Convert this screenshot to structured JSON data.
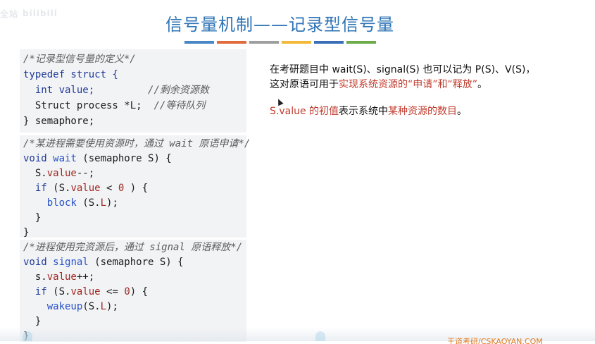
{
  "watermark": {
    "small_text": "全站",
    "logo_text": "bilibili"
  },
  "title": "信号量机制——记录型信号量",
  "colorbar": [
    "#4a86c6",
    "#e06c3c",
    "#9e9e9e",
    "#f2b93b",
    "#3a6fb8",
    "#6cab4a"
  ],
  "code_block_1": [
    [
      {
        "t": "/*记录型信号量的定义*/",
        "c": "comment"
      }
    ],
    [
      {
        "t": "typedef struct {",
        "c": "kw"
      }
    ],
    [
      {
        "t": "  int value;         ",
        "c": "kw"
      },
      {
        "t": "//剩余资源数",
        "c": "comment"
      }
    ],
    [
      {
        "t": "  Struct process ",
        "c": "plain"
      },
      {
        "t": "*L",
        "c": "plain"
      },
      {
        "t": ";  ",
        "c": "plain"
      },
      {
        "t": "//等待队列",
        "c": "comment"
      }
    ],
    [
      {
        "t": "} semaphore;",
        "c": "plain"
      }
    ]
  ],
  "code_block_2": [
    [
      {
        "t": "/*某进程需要使用资源时，通过 wait 原语申请*/",
        "c": "comment"
      }
    ],
    [
      {
        "t": "void ",
        "c": "kw"
      },
      {
        "t": "wait",
        "c": "fn"
      },
      {
        "t": " (semaphore S) {",
        "c": "plain"
      }
    ],
    [
      {
        "t": "  S.",
        "c": "plain"
      },
      {
        "t": "value",
        "c": "var"
      },
      {
        "t": "--;",
        "c": "plain"
      }
    ],
    [
      {
        "t": "  if ",
        "c": "kw"
      },
      {
        "t": "(S.",
        "c": "plain"
      },
      {
        "t": "value",
        "c": "var"
      },
      {
        "t": " < ",
        "c": "plain"
      },
      {
        "t": "0",
        "c": "num"
      },
      {
        "t": " ) {",
        "c": "plain"
      }
    ],
    [
      {
        "t": "    block ",
        "c": "fn"
      },
      {
        "t": "(S.",
        "c": "plain"
      },
      {
        "t": "L",
        "c": "var"
      },
      {
        "t": ");",
        "c": "plain"
      }
    ],
    [
      {
        "t": "  }",
        "c": "plain"
      }
    ],
    [
      {
        "t": "}",
        "c": "plain"
      }
    ]
  ],
  "code_block_3": [
    [
      {
        "t": "/*进程使用完资源后，通过 signal 原语释放*/",
        "c": "comment"
      }
    ],
    [
      {
        "t": "void ",
        "c": "kw"
      },
      {
        "t": "signal",
        "c": "fn"
      },
      {
        "t": " (semaphore S) {",
        "c": "plain"
      }
    ],
    [
      {
        "t": "  s.",
        "c": "plain"
      },
      {
        "t": "value",
        "c": "var"
      },
      {
        "t": "++;",
        "c": "plain"
      }
    ],
    [
      {
        "t": "  if ",
        "c": "kw"
      },
      {
        "t": "(S.",
        "c": "plain"
      },
      {
        "t": "value",
        "c": "var"
      },
      {
        "t": " <= ",
        "c": "plain"
      },
      {
        "t": "0",
        "c": "num"
      },
      {
        "t": ") {",
        "c": "plain"
      }
    ],
    [
      {
        "t": "    wakeup",
        "c": "fn"
      },
      {
        "t": "(S.",
        "c": "plain"
      },
      {
        "t": "L",
        "c": "var"
      },
      {
        "t": ");",
        "c": "plain"
      }
    ],
    [
      {
        "t": "  }",
        "c": "plain"
      }
    ],
    [
      {
        "t": "}",
        "c": "plain"
      }
    ]
  ],
  "paragraph_1": {
    "line1": "在考研题目中 wait(S)、signal(S)  也可以记为 P(S)、V(S)，",
    "line2_prefix": "这对原语可用于",
    "line2_red": "实现系统资源的“申请”和“释放”",
    "line2_suffix": "。"
  },
  "paragraph_2": {
    "red1": "S.value 的初值",
    "mid": "表示系统中",
    "red2": "某种资源的数目",
    "suffix": "。"
  },
  "footer_logo_text": "王道考研/CSKAOYAN.COM"
}
